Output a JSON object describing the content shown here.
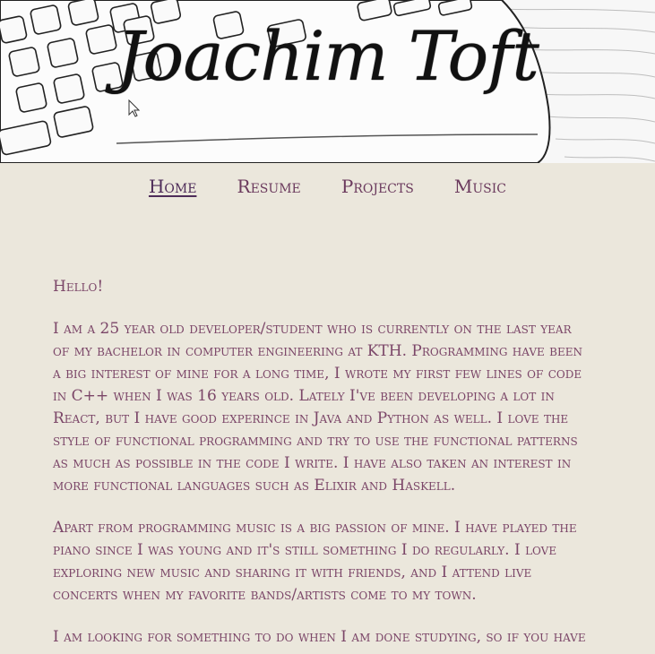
{
  "header": {
    "site_title": "Joachim Toft"
  },
  "nav": {
    "items": [
      {
        "label": "Home",
        "active": true
      },
      {
        "label": "Resume",
        "active": false
      },
      {
        "label": "Projects",
        "active": false
      },
      {
        "label": "Music",
        "active": false
      }
    ]
  },
  "content": {
    "greeting": "Hello!",
    "paragraphs": [
      "I am a 25 year old developer/student who is currently on the last year of my bachelor in computer engineering at KTH. Programming have been a big interest of mine for a long time, I wrote my first few lines of code in C++ when I was 16 years old. Lately I've been developing a lot in React, but I have good experince in Java and Python as well. I love the style of functional programming and try to use the functional patterns as much as possible in the code I write. I have also taken an interest in more functional languages such as Elixir and Haskell.",
      "Apart from programming music is a big passion of mine. I have played the piano since I was young and it's still something I do regularly. I love exploring new music and sharing it with friends, and I attend live concerts when my favorite bands/artists come to my town.",
      "I am looking for something to do when I am done studying, so if you have"
    ]
  },
  "colors": {
    "background": "#ebe7dc",
    "text": "#7b4668",
    "nav_active": "#4e2c59"
  }
}
